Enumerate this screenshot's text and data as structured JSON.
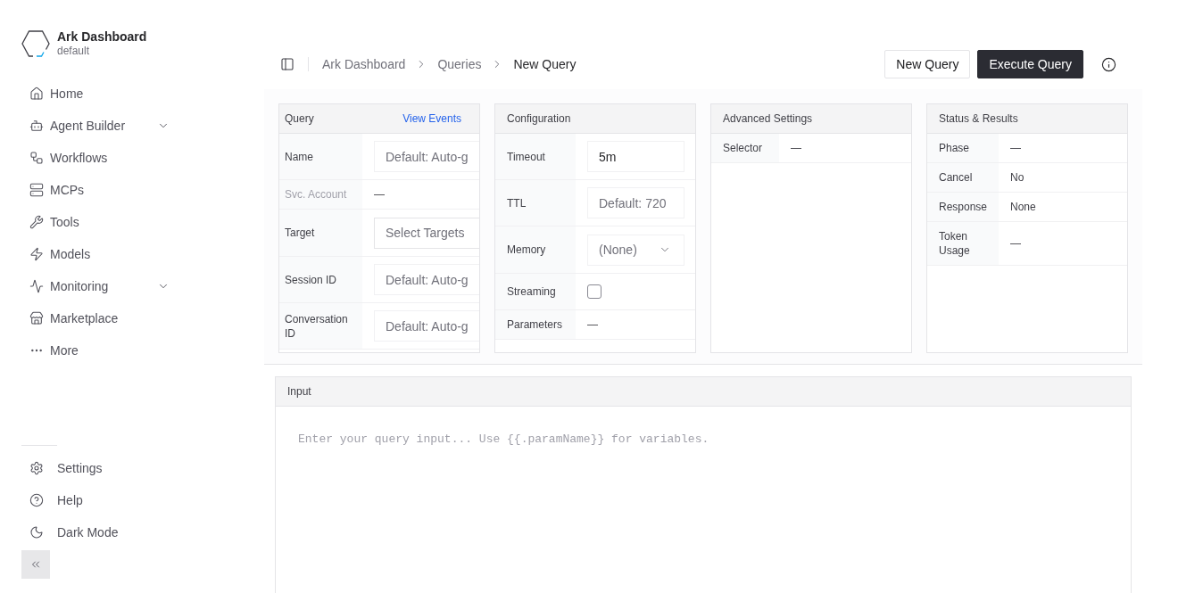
{
  "sidebar": {
    "brand": {
      "title": "Ark Dashboard",
      "subtitle": "default"
    },
    "nav_items": [
      {
        "label": "Home",
        "kind": "link"
      },
      {
        "label": "Agent Builder",
        "kind": "group"
      },
      {
        "label": "Workflows",
        "kind": "link"
      },
      {
        "label": "MCPs",
        "kind": "link"
      },
      {
        "label": "Tools",
        "kind": "link"
      },
      {
        "label": "Models",
        "kind": "link"
      },
      {
        "label": "Monitoring",
        "kind": "group"
      },
      {
        "label": "Marketplace",
        "kind": "link"
      },
      {
        "label": "More",
        "kind": "link"
      }
    ],
    "footer_items": [
      {
        "label": "Settings"
      },
      {
        "label": "Help"
      },
      {
        "label": "Dark Mode"
      }
    ]
  },
  "header": {
    "breadcrumbs": [
      {
        "label": "Ark Dashboard",
        "current": false
      },
      {
        "label": "Queries",
        "current": false
      },
      {
        "label": "New Query",
        "current": true
      }
    ],
    "buttons": [
      {
        "label": "New Query",
        "kind": "secondary"
      },
      {
        "label": "Execute Query",
        "kind": "primary"
      }
    ]
  },
  "cards": [
    {
      "title": "Query",
      "link": "View Events",
      "rows": [
        {
          "label": "Name",
          "kind": "input",
          "placeholder": "Default: Auto-g",
          "disabled": false
        },
        {
          "label": "Svc. Account",
          "kind": "text",
          "value": "—",
          "disabled": true
        },
        {
          "label": "Target",
          "kind": "picker",
          "placeholder": "Select Targets",
          "disabled": false
        },
        {
          "label": "Session ID",
          "kind": "input",
          "placeholder": "Default: Auto-g",
          "disabled": false
        },
        {
          "label": "Conversation ID",
          "kind": "input",
          "placeholder": "Default: Auto-g",
          "disabled": false
        }
      ]
    },
    {
      "title": "Configuration",
      "rows": [
        {
          "label": "Timeout",
          "kind": "input",
          "value": "5m"
        },
        {
          "label": "TTL",
          "kind": "input",
          "placeholder": "Default: 720"
        },
        {
          "label": "Memory",
          "kind": "select",
          "value": "(None)"
        },
        {
          "label": "Streaming",
          "kind": "checkbox",
          "checked": false
        },
        {
          "label": "Parameters",
          "kind": "text",
          "value": "—"
        }
      ]
    },
    {
      "title": "Advanced Settings",
      "rows": [
        {
          "label": "Selector",
          "kind": "text",
          "value": "—"
        }
      ]
    },
    {
      "title": "Status & Results",
      "rows": [
        {
          "label": "Phase",
          "kind": "text",
          "value": "—"
        },
        {
          "label": "Cancel",
          "kind": "text",
          "value": "No"
        },
        {
          "label": "Response",
          "kind": "text",
          "value": "None"
        },
        {
          "label": "Token Usage",
          "kind": "text",
          "value": "—"
        }
      ]
    }
  ],
  "input_section": {
    "title": "Input",
    "placeholder": "Enter your query input... Use {{.paramName}} for variables."
  }
}
